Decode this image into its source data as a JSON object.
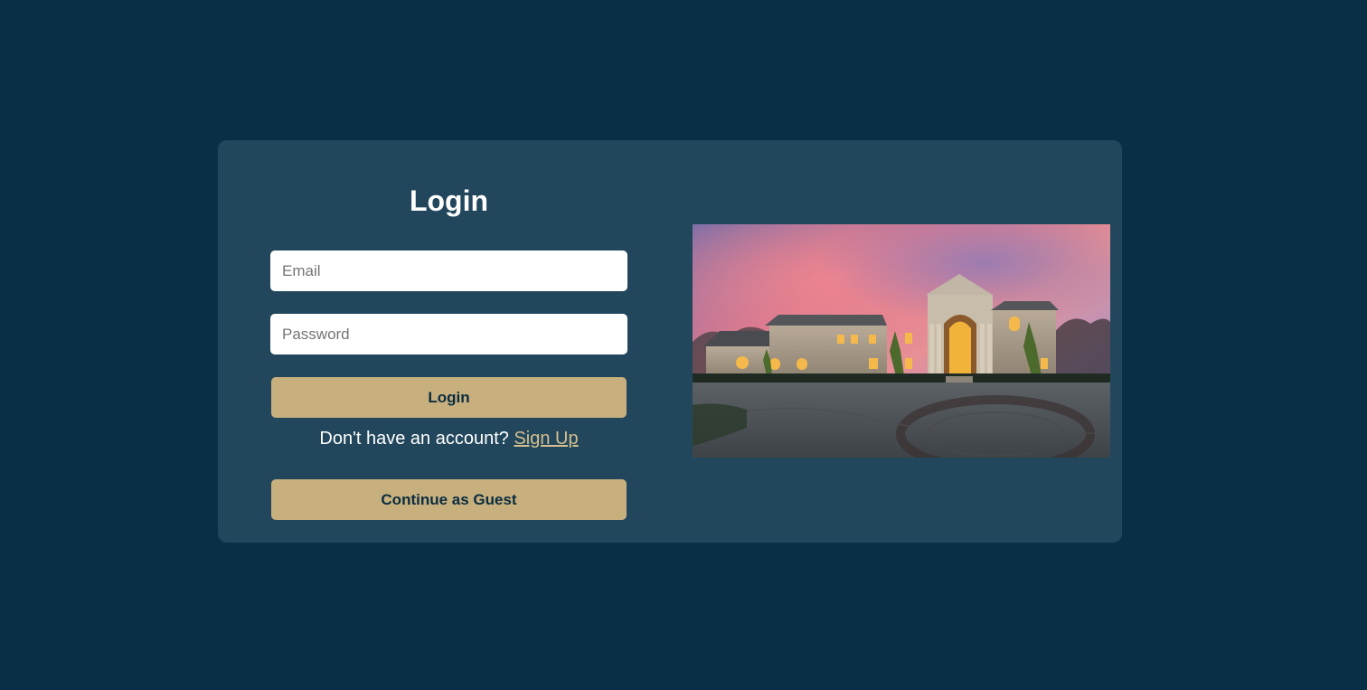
{
  "login": {
    "title": "Login",
    "email_placeholder": "Email",
    "password_placeholder": "Password",
    "login_button": "Login",
    "signup_prompt": "Don't have an account?",
    "signup_link": "Sign Up",
    "guest_button": "Continue as Guest"
  },
  "image": {
    "subject": "mansion-at-sunset-photo"
  },
  "colors": {
    "page_bg": "#082f46",
    "card_bg": "#22475c",
    "accent": "#c7b07d",
    "link": "#d4bf8f"
  }
}
